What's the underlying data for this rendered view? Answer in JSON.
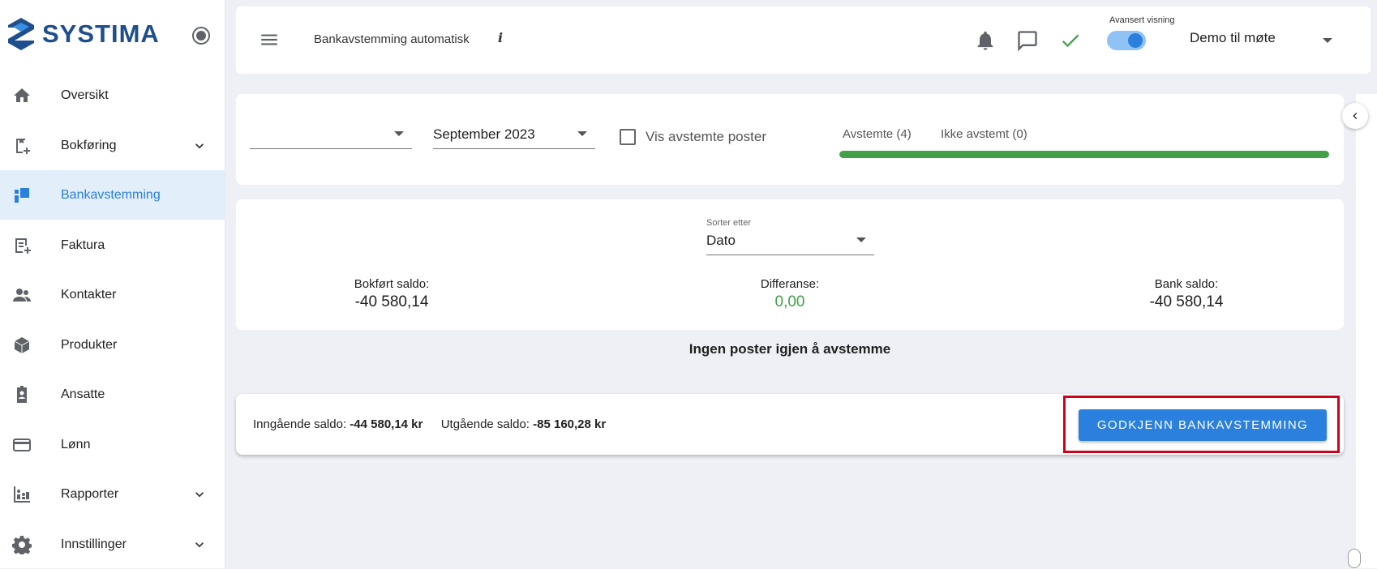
{
  "app": {
    "brand": "SYSTIMA"
  },
  "sidebar": {
    "items": [
      {
        "label": "Oversikt",
        "icon": "home-icon"
      },
      {
        "label": "Bokføring",
        "icon": "bookkeeping-icon",
        "expandable": true
      },
      {
        "label": "Bankavstemming",
        "icon": "bank-reconciliation-icon",
        "active": true
      },
      {
        "label": "Faktura",
        "icon": "invoice-icon"
      },
      {
        "label": "Kontakter",
        "icon": "contacts-icon"
      },
      {
        "label": "Produkter",
        "icon": "box-icon"
      },
      {
        "label": "Ansatte",
        "icon": "badge-icon"
      },
      {
        "label": "Lønn",
        "icon": "credit-card-icon"
      },
      {
        "label": "Rapporter",
        "icon": "reports-icon",
        "expandable": true
      },
      {
        "label": "Innstillinger",
        "icon": "gear-icon",
        "expandable": true
      }
    ]
  },
  "header": {
    "title": "Bankavstemming automatisk",
    "info_glyph": "i",
    "advanced_view_label": "Avansert visning",
    "advanced_view_on": true,
    "company": "Demo til møte"
  },
  "filters": {
    "account_value": "",
    "period_value": "September 2023",
    "show_reconciled_label": "Vis avstemte poster",
    "show_reconciled_checked": false,
    "tabs": [
      "Avstemte (4)",
      "Ikke avstemt (0)"
    ],
    "progress_fraction": 1.0
  },
  "summary": {
    "sort_label": "Sorter etter",
    "sort_value": "Dato",
    "booked_label": "Bokført saldo:",
    "booked_value": "-40 580,14",
    "diff_label": "Differanse:",
    "diff_value": "0,00",
    "bank_label": "Bank saldo:",
    "bank_value": "-40 580,14"
  },
  "empty_message": "Ingen poster igjen å avstemme",
  "footer": {
    "opening_label": "Inngående saldo:",
    "opening_value": "-44 580,14 kr",
    "closing_label": "Utgående saldo:",
    "closing_value": "-85 160,28 kr",
    "approve_button": "GODKJENN BANKAVSTEMMING"
  },
  "colors": {
    "accent": "#2b80de",
    "success": "#43a047",
    "highlight": "#d0021b",
    "brand": "#1e4f8c"
  }
}
